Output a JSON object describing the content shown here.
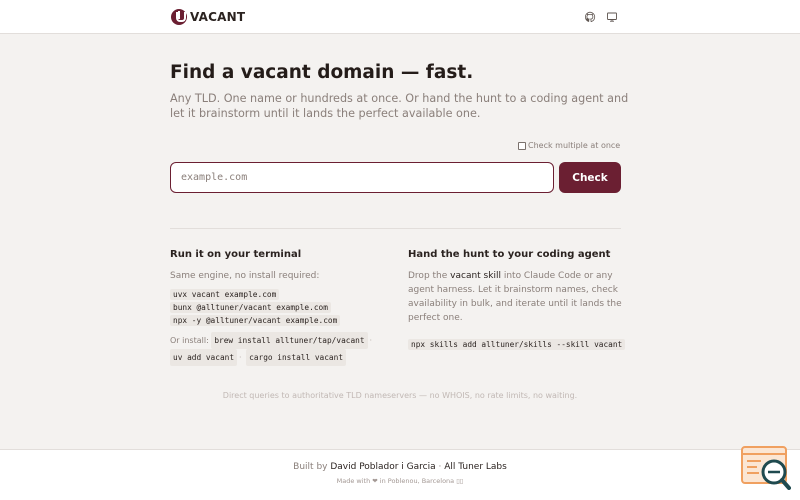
{
  "header": {
    "logo_text": "VACANT",
    "icons": [
      "github-icon",
      "monitor-icon"
    ]
  },
  "hero": {
    "title": "Find a vacant domain — fast.",
    "subtitle": "Any TLD. One name or hundreds at once. Or hand the hunt to a coding agent and let it brainstorm until it lands the perfect available one."
  },
  "search": {
    "multi_label": "Check multiple at once",
    "multi_checked": false,
    "placeholder": "example.com",
    "value": "",
    "button_label": "Check"
  },
  "terminal": {
    "heading": "Run it on your terminal",
    "intro": "Same engine, no install required:",
    "commands": [
      "uvx vacant example.com",
      "bunx @alltuner/vacant example.com",
      "npx -y @alltuner/vacant example.com"
    ],
    "install_label": "Or install:",
    "install_commands": [
      "brew install alltuner/tap/vacant",
      "uv add vacant",
      "cargo install vacant"
    ],
    "separator": "·"
  },
  "agent": {
    "heading": "Hand the hunt to your coding agent",
    "text_before": "Drop the ",
    "link": "vacant skill",
    "text_after": " into Claude Code or any agent harness. Let it brainstorm names, check availability in bulk, and iterate until it lands the perfect one.",
    "command": "npx skills add alltuner/skills --skill vacant"
  },
  "footnote": "Direct queries to authoritative TLD nameservers — no WHOIS, no rate limits, no waiting.",
  "footer": {
    "built_prefix": "Built by ",
    "author": "David Poblador i Garcia",
    "sep": " · ",
    "company": "All Tuner Labs",
    "made_with": "Made with ❤ in Poblenou, Barcelona ▯▯"
  },
  "colors": {
    "accent": "#6b1f32",
    "background": "#f4f2f0",
    "muted_text": "#8a7f7a",
    "widget_orange": "#f0a060",
    "widget_teal": "#1f4a4f"
  }
}
